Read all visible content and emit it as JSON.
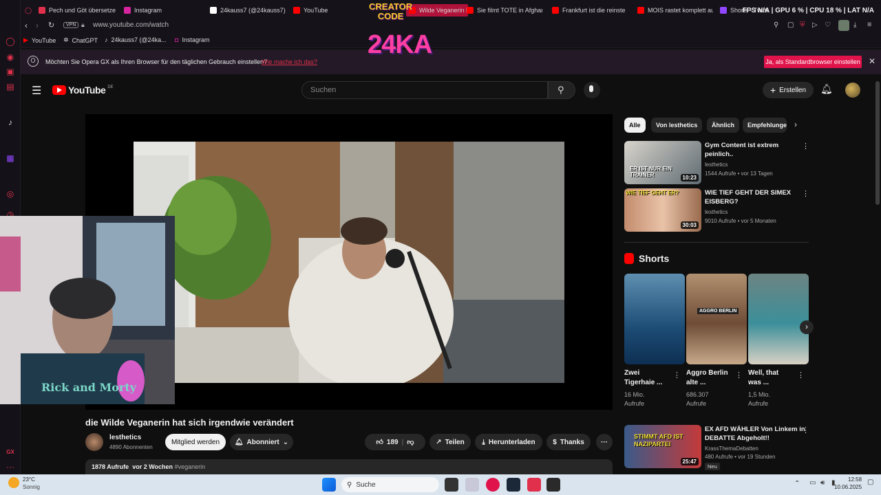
{
  "browser": {
    "tabs": [
      {
        "label": "Pech und Göt übersetze",
        "color": "#e0304c"
      },
      {
        "label": "Instagram",
        "color": "#d6249f"
      },
      {
        "label": "24kauss7 (@24kauss7)",
        "color": "#ffffff"
      },
      {
        "label": "YouTube",
        "color": "#ff0000"
      },
      {
        "label": "Wilde Veganerin h",
        "color": "#ff0000"
      },
      {
        "label": "Sie filmt TOTE in Afghan",
        "color": "#ff0000"
      },
      {
        "label": "Frankfurt ist die reinste",
        "color": "#ff0000"
      },
      {
        "label": "MOIS rastet komplett au",
        "color": "#ff0000"
      },
      {
        "label": "Shorts - Twitter",
        "color": "#9146ff"
      }
    ],
    "stats": {
      "fps": "FPS N/A",
      "gpu": "GPU 6 %",
      "cpu": "CPU 18 %",
      "lat": "LAT N/A"
    },
    "url": "www.youtube.com/watch",
    "vpn": "VPN",
    "bookmarks": [
      "YouTube",
      "ChatGPT",
      "24kauss7 (@24ka...",
      "Instagram"
    ],
    "banner": {
      "text": "Möchten Sie Opera GX als Ihren Browser für den täglichen Gebrauch einstellen?",
      "link": "Wie mache ich das?",
      "button": "Ja, als Standardbrowser einstellen"
    }
  },
  "overlay": {
    "line1": "CREATOR",
    "line2": "CODE",
    "brand": "24KA"
  },
  "youtube": {
    "logo_text": "YouTube",
    "country": "DE",
    "search_placeholder": "Suchen",
    "create_label": "Erstellen",
    "video": {
      "title": "die Wilde Veganerin hat sich irgendwie verändert",
      "channel": "lesthetics",
      "subscribers": "4890 Abonnenten",
      "member_label": "Mitglied werden",
      "subscribed_label": "Abonniert",
      "likes": "189",
      "share_label": "Teilen",
      "download_label": "Herunterladen",
      "thanks_label": "Thanks",
      "views": "1878 Aufrufe",
      "age": "vor 2 Wochen",
      "hashtag": "#veganerin"
    },
    "chips": [
      "Alle",
      "Von lesthetics",
      "Ähnlich",
      "Empfehlunge"
    ],
    "related": [
      {
        "title_l1": "Gym Content ist extrem",
        "title_l2": "peinlich..",
        "channel": "lesthetics",
        "meta": "1544 Aufrufe • vor 13 Tagen",
        "duration": "10:23",
        "thumb_text": "ER IST NUR EIN TRAINER"
      },
      {
        "title_l1": "WIE TIEF GEHT DER SIMEX",
        "title_l2": "EISBERG?",
        "channel": "lesthetics",
        "meta": "9010 Aufrufe • vor 5 Monaten",
        "duration": "30:03",
        "thumb_text": "WIE TIEF GEHT ER?"
      },
      {
        "title_l1": "EX AFD WÄHLER Von Linkem in",
        "title_l2": "DEBATTE Abgeholt!!",
        "channel": "KrassThemaDebatten",
        "meta": "480 Aufrufe • vor 19 Stunden",
        "duration": "25:47",
        "thumb_text": "STIMMT AFD IST NAZIPARTEI",
        "badge": "Neu"
      }
    ],
    "shorts_heading": "Shorts",
    "shorts": [
      {
        "title_l1": "Zwei",
        "title_l2": "Tigerhaie ...",
        "views_l1": "16 Mio.",
        "views_l2": "Aufrufe",
        "color": "#2d6d9a"
      },
      {
        "title_l1": "Aggro Berlin",
        "title_l2": "alte ...",
        "views_l1": "686.307",
        "views_l2": "Aufrufe",
        "color": "#8a6a52",
        "thumb_text": "AGGRO BERLIN"
      },
      {
        "title_l1": "Well, that",
        "title_l2": "was ...",
        "views_l1": "1,5 Mio.",
        "views_l2": "Aufrufe",
        "color": "#5d7a72"
      }
    ]
  },
  "webcam": {
    "shirt_text": "Rick and Morty"
  },
  "taskbar": {
    "weather_temp": "23°C",
    "weather_desc": "Sonnig",
    "search_label": "Suche",
    "time": "12:58",
    "date": "10.06.2025"
  }
}
